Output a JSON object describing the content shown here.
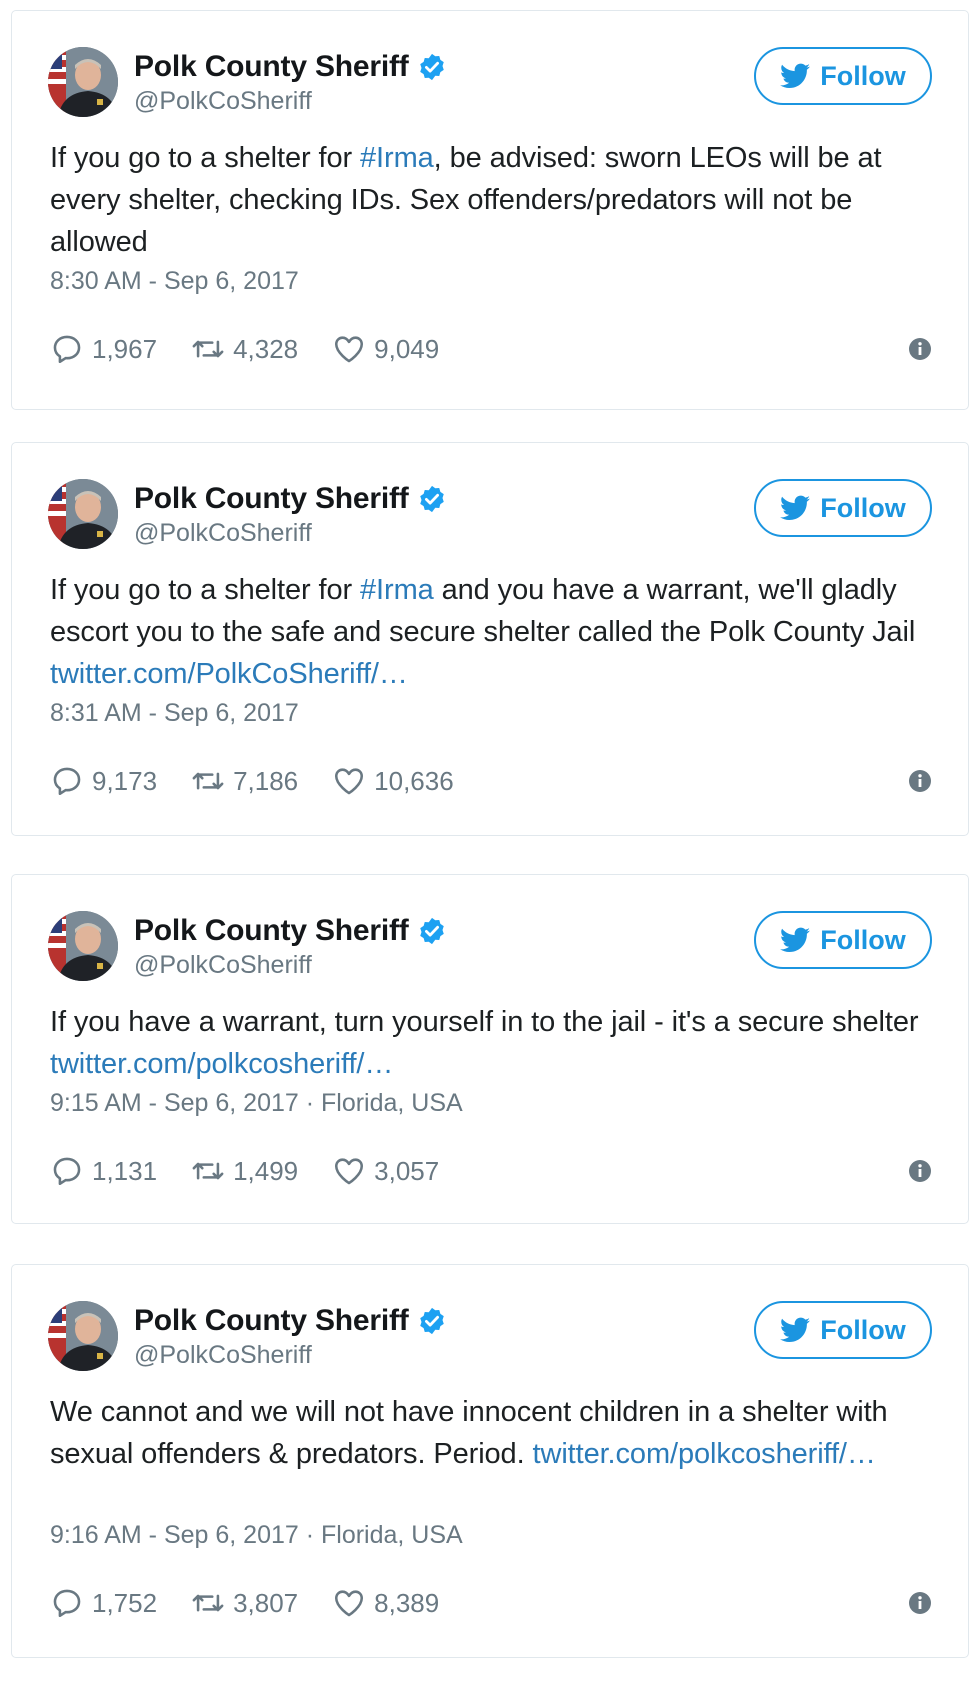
{
  "colors": {
    "link": "#2b7bb9",
    "follow": "#1b95e0",
    "verified": "#1da1f2",
    "meta": "#697882",
    "border": "#e1e8ed"
  },
  "tweets": [
    {
      "display_name": "Polk County Sheriff",
      "handle": "@PolkCoSheriff",
      "follow_label": "Follow",
      "text_before": "If you go to a shelter for ",
      "hashtag": "#Irma",
      "text_after": ", be advised: sworn LEOs will be at every shelter, checking IDs. Sex offenders/predators will not be allowed",
      "link": "",
      "timestamp": "8:30 AM - Sep 6, 2017",
      "location": "",
      "replies": "1,967",
      "retweets": "4,328",
      "likes": "9,049"
    },
    {
      "display_name": "Polk County Sheriff",
      "handle": "@PolkCoSheriff",
      "follow_label": "Follow",
      "text_before": "If you go to a shelter for ",
      "hashtag": "#Irma",
      "text_after": " and you have a warrant, we'll gladly escort you to the safe and secure shelter called the Polk County Jail ",
      "link": "twitter.com/PolkCoSheriff/…",
      "timestamp": "8:31 AM - Sep 6, 2017",
      "location": "",
      "replies": "9,173",
      "retweets": "7,186",
      "likes": "10,636"
    },
    {
      "display_name": "Polk County Sheriff",
      "handle": "@PolkCoSheriff",
      "follow_label": "Follow",
      "text_before": "If you have a warrant, turn yourself in to the jail - it's a secure shelter ",
      "hashtag": "",
      "text_after": "",
      "link": "twitter.com/polkcosheriff/…",
      "timestamp": "9:15 AM - Sep 6, 2017",
      "location": " · Florida, USA",
      "replies": "1,131",
      "retweets": "1,499",
      "likes": "3,057"
    },
    {
      "display_name": "Polk County Sheriff",
      "handle": "@PolkCoSheriff",
      "follow_label": "Follow",
      "text_before": "We cannot and we will not have innocent children in a shelter with sexual offenders & predators. Period. ",
      "hashtag": "",
      "text_after": "",
      "link": "twitter.com/polkcosheriff/…",
      "timestamp": "9:16 AM - Sep 6, 2017",
      "location": " · Florida, USA",
      "replies": "1,752",
      "retweets": "3,807",
      "likes": "8,389"
    }
  ]
}
